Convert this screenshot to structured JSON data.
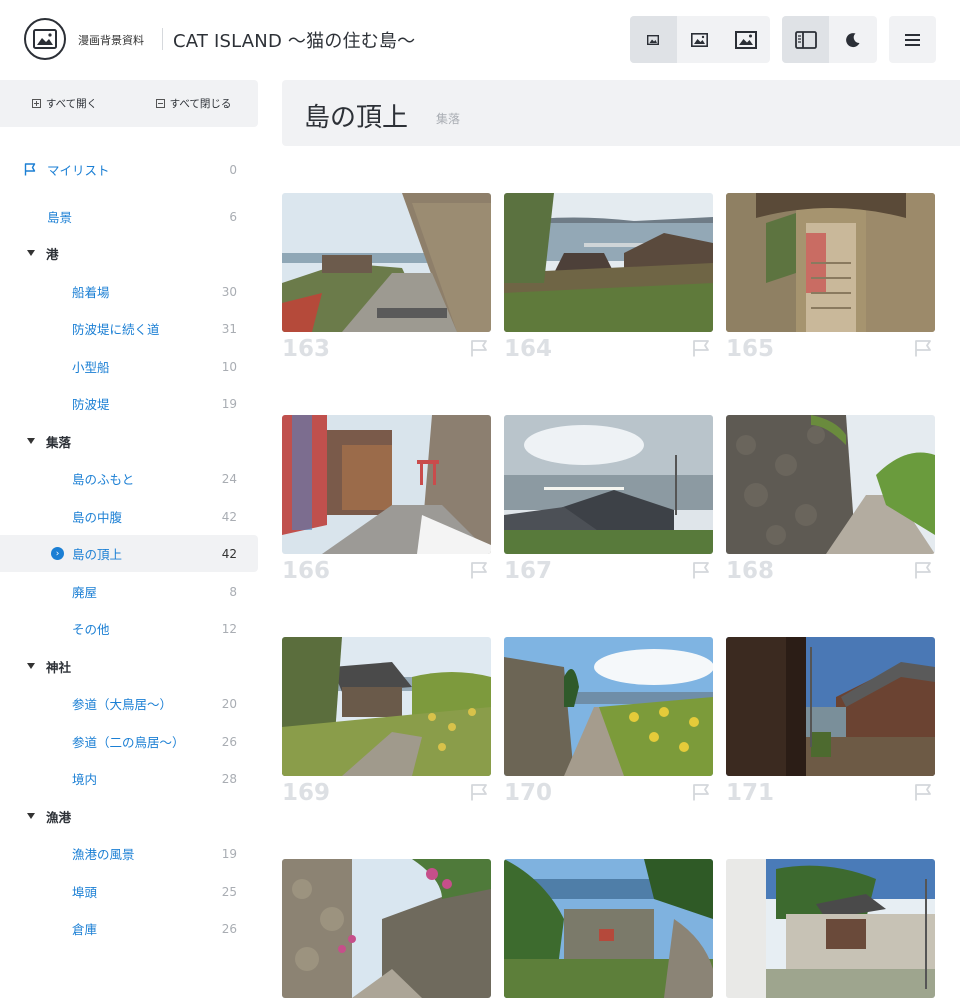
{
  "header": {
    "brand": "漫画背景資料",
    "title": "CAT ISLAND 〜猫の住む島〜",
    "size_buttons": [
      "image-small-icon",
      "image-medium-icon",
      "image-large-icon"
    ],
    "view_buttons": [
      "sidebar-toggle-icon",
      "moon-icon"
    ],
    "menu_icon": "hamburger-icon"
  },
  "toolbar": {
    "expand_all": "すべて開く",
    "collapse_all": "すべて閉じる"
  },
  "sidebar": {
    "mylist": {
      "label": "マイリスト",
      "count": "0"
    },
    "items": [
      {
        "label": "島景",
        "count": "6",
        "level": 1
      },
      {
        "label": "港",
        "level": 0
      },
      {
        "label": "船着場",
        "count": "30",
        "level": 2
      },
      {
        "label": "防波堤に続く道",
        "count": "31",
        "level": 2
      },
      {
        "label": "小型船",
        "count": "10",
        "level": 2
      },
      {
        "label": "防波堤",
        "count": "19",
        "level": 2
      },
      {
        "label": "集落",
        "level": 0
      },
      {
        "label": "島のふもと",
        "count": "24",
        "level": 2
      },
      {
        "label": "島の中腹",
        "count": "42",
        "level": 2
      },
      {
        "label": "島の頂上",
        "count": "42",
        "level": 2,
        "active": true
      },
      {
        "label": "廃屋",
        "count": "8",
        "level": 2
      },
      {
        "label": "その他",
        "count": "12",
        "level": 2
      },
      {
        "label": "神社",
        "level": 0
      },
      {
        "label": "参道（大鳥居〜）",
        "count": "20",
        "level": 2
      },
      {
        "label": "参道（二の鳥居〜）",
        "count": "26",
        "level": 2
      },
      {
        "label": "境内",
        "count": "28",
        "level": 2
      },
      {
        "label": "漁港",
        "level": 0
      },
      {
        "label": "漁港の風景",
        "count": "19",
        "level": 2
      },
      {
        "label": "埠頭",
        "count": "25",
        "level": 2
      },
      {
        "label": "倉庫",
        "count": "26",
        "level": 2
      }
    ]
  },
  "main": {
    "title": "島の頂上",
    "subtitle": "集落",
    "photos": [
      {
        "num": "163",
        "scene": "stone-wall-lane"
      },
      {
        "num": "164",
        "scene": "village-sea"
      },
      {
        "num": "165",
        "scene": "stone-stairs"
      },
      {
        "num": "166",
        "scene": "colorful-shed"
      },
      {
        "num": "167",
        "scene": "roofs-sea"
      },
      {
        "num": "168",
        "scene": "stone-wall-path"
      },
      {
        "num": "169",
        "scene": "overgrown-house"
      },
      {
        "num": "170",
        "scene": "yellow-flowers-path"
      },
      {
        "num": "171",
        "scene": "wooden-houses"
      },
      {
        "num": "",
        "scene": "flower-wall"
      },
      {
        "num": "",
        "scene": "tree-sea"
      },
      {
        "num": "",
        "scene": "white-house"
      }
    ]
  },
  "colors": {
    "accent": "#1b7fd4",
    "panel": "#f1f2f4",
    "muted": "#a9adb3"
  }
}
